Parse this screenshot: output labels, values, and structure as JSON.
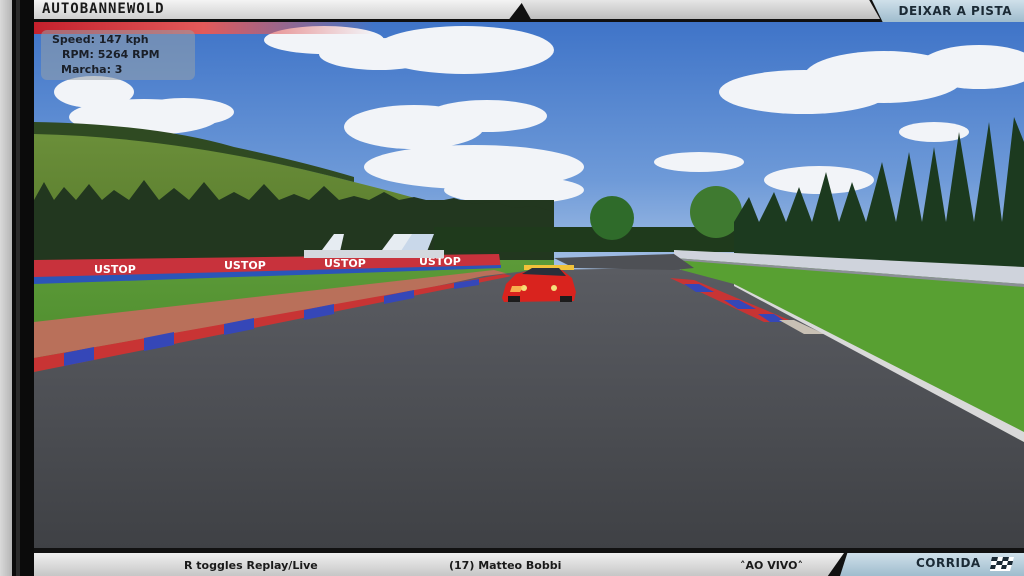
{
  "hud": {
    "track_name": "AUTOBANNEWOLD",
    "exit_button": "DEIXAR A PISTA",
    "telemetry": {
      "speed": "Speed:  147 kph",
      "rpm": "RPM:  5264 RPM",
      "gear": "Marcha:  3"
    }
  },
  "footer": {
    "replay_hint": "R toggles Replay/Live",
    "driver": "(17) Matteo Bobbi",
    "live_label": "˄AO VIVO˄",
    "race_button": "CORRIDA",
    "flag_icon": "checkered-flag-icon"
  },
  "scene": {
    "banner_text": "USTOP"
  },
  "colors": {
    "sky": "#5d8fd3",
    "grass": "#5f9a3a",
    "asphalt": "#4b4d52",
    "car": "#d9231e",
    "kerb_red": "#c83434",
    "kerb_blue": "#3547b8",
    "panel_light": "#e6e6e6",
    "panel_blue": "#b4cad8"
  }
}
